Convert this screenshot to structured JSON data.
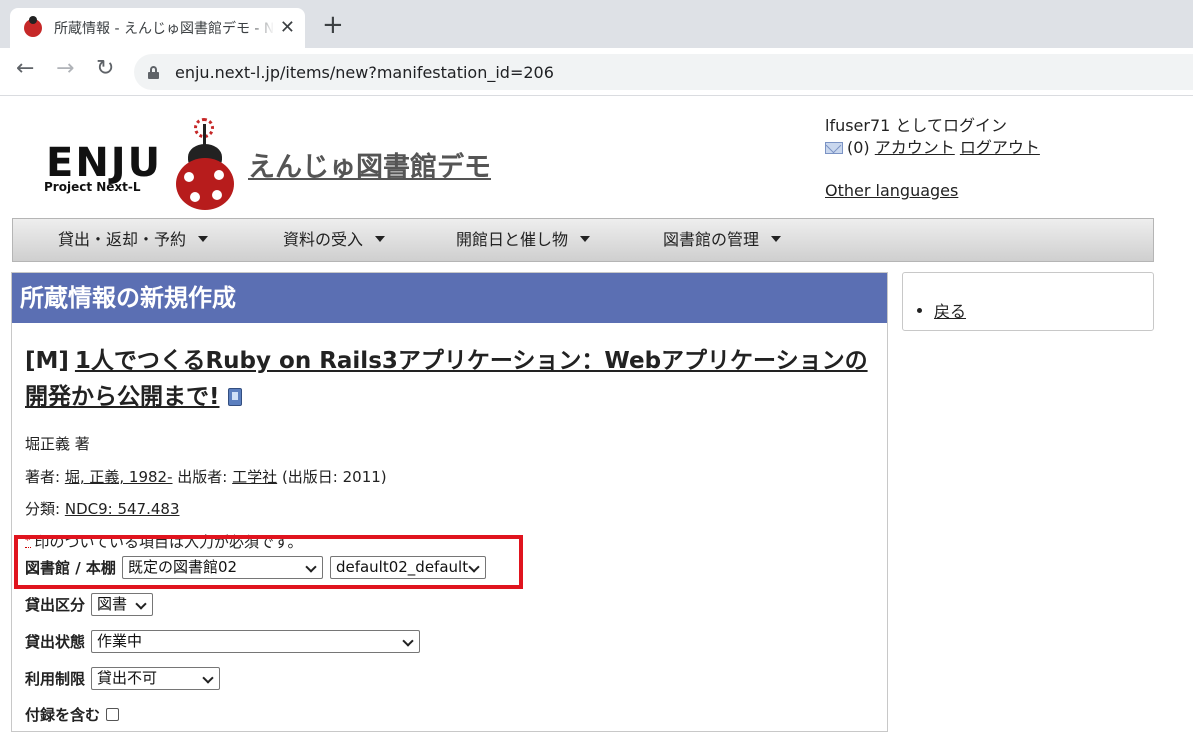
{
  "browser": {
    "tab_title": "所蔵情報 - えんじゅ図書館デモ - Next-L Enju",
    "url": "enju.next-l.jp/items/new?manifestation_id=206"
  },
  "header": {
    "logo_text": "ENJU",
    "logo_sub": "Project Next-L",
    "site_title": "えんじゅ図書館デモ",
    "login_status": "lfuser71 としてログイン",
    "message_count": "(0)",
    "account_link": "アカウント",
    "logout_link": "ログアウト",
    "other_languages": "Other languages"
  },
  "menu": {
    "items": [
      {
        "label": "貸出・返却・予約"
      },
      {
        "label": "資料の受入"
      },
      {
        "label": "開館日と催し物"
      },
      {
        "label": "図書館の管理"
      }
    ]
  },
  "main": {
    "heading": "所蔵情報の新規作成",
    "book": {
      "prefix": "[M]",
      "title": "1人でつくるRuby on Rails3アプリケーション：Webアプリケーションの開発から公開まで!"
    },
    "statement": "堀正義 著",
    "creator_label": "著者:",
    "creator_link": "堀, 正義, 1982-",
    "publisher_label": "出版者:",
    "publisher_link": "工学社",
    "pub_date": "(出版日: 2011)",
    "classification_label": "分類:",
    "classification_link": "NDC9: 547.483",
    "required_mark": "*",
    "required_notice": "印のついている項目は入力が必須です。",
    "form": {
      "library_label": "図書館 / 本棚",
      "library_value": "既定の図書館02",
      "shelf_value": "default02_default",
      "checkout_type_label": "貸出区分",
      "checkout_type_value": "図書",
      "circulation_status_label": "貸出状態",
      "circulation_status_value": "作業中",
      "use_restriction_label": "利用制限",
      "use_restriction_value": "貸出不可",
      "include_supplements_label": "付録を含む"
    }
  },
  "sidebar": {
    "back_link": "戻る"
  },
  "colors": {
    "heading_bg": "#5b6fb3",
    "highlight": "#e0141e"
  }
}
